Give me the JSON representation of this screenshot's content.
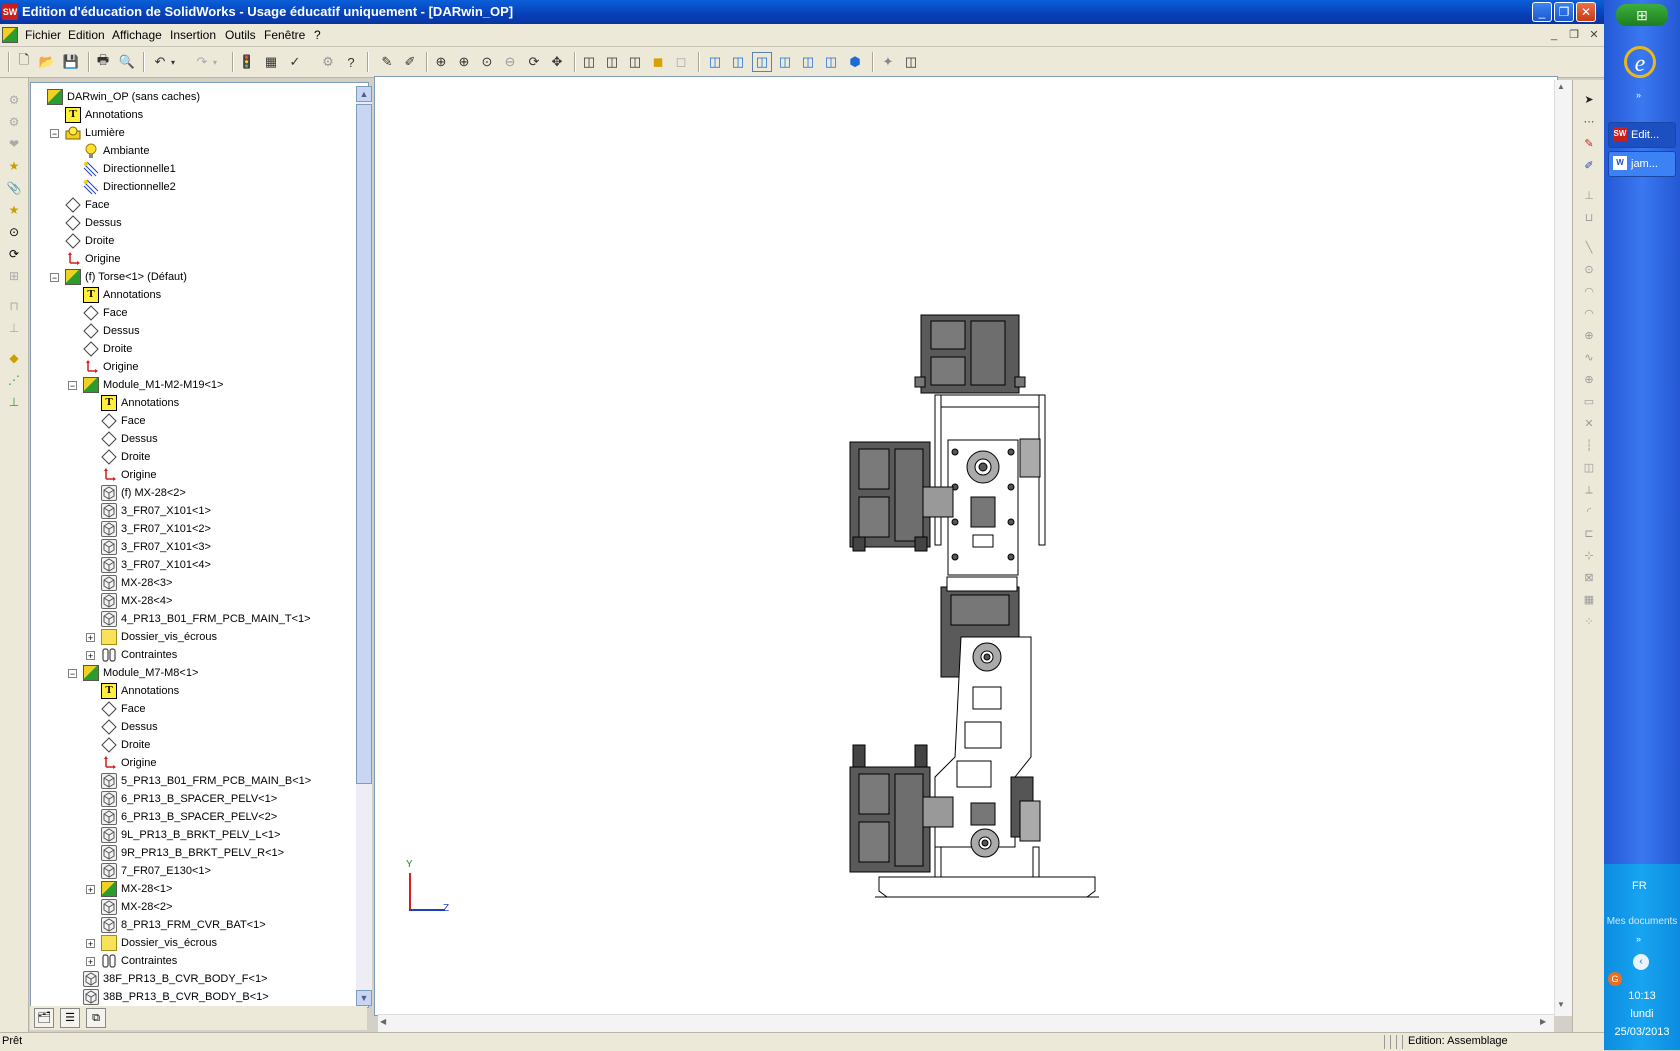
{
  "window": {
    "title": "Edition d'éducation de SolidWorks - Usage éducatif uniquement - [DARwin_OP]",
    "app_icon": "solidworks-logo",
    "controls": [
      "minimize",
      "restore",
      "close"
    ]
  },
  "menu": {
    "items": [
      "Fichier",
      "Edition",
      "Affichage",
      "Insertion",
      "Outils",
      "Fenêtre",
      "?"
    ]
  },
  "toolbar": {
    "buttons": [
      "new",
      "open",
      "save",
      "print",
      "print-preview",
      "undo",
      "redo",
      "rebuild",
      "options",
      "help",
      "zoom-to-fit",
      "zoom-in",
      "zoom-area",
      "zoom-out",
      "rotate",
      "pan",
      "front-view",
      "top-view",
      "right-view",
      "isometric-view",
      "wireframe",
      "hidden-lines",
      "shaded",
      "section",
      "perspective"
    ]
  },
  "tree": {
    "items": [
      {
        "label": "DARwin_OP  (sans caches)",
        "level": 0,
        "icon": "assembly-icon",
        "expander": ""
      },
      {
        "label": "Annotations",
        "level": 1,
        "icon": "annotation-icon",
        "expander": ""
      },
      {
        "label": "Lumière",
        "level": 1,
        "icon": "light-icon",
        "expander": "-"
      },
      {
        "label": "Ambiante",
        "level": 2,
        "icon": "bulb-icon",
        "expander": ""
      },
      {
        "label": "Directionnelle1",
        "level": 2,
        "icon": "directional-light-icon",
        "expander": ""
      },
      {
        "label": "Directionnelle2",
        "level": 2,
        "icon": "directional-light-icon",
        "expander": ""
      },
      {
        "label": "Face",
        "level": 1,
        "icon": "plane-icon",
        "expander": ""
      },
      {
        "label": "Dessus",
        "level": 1,
        "icon": "plane-icon",
        "expander": ""
      },
      {
        "label": "Droite",
        "level": 1,
        "icon": "plane-icon",
        "expander": ""
      },
      {
        "label": "Origine",
        "level": 1,
        "icon": "origin-icon",
        "expander": ""
      },
      {
        "label": "(f) Torse<1> (Défaut)",
        "level": 1,
        "icon": "assembly-icon",
        "expander": "-"
      },
      {
        "label": "Annotations",
        "level": 2,
        "icon": "annotation-icon",
        "expander": ""
      },
      {
        "label": "Face",
        "level": 2,
        "icon": "plane-icon",
        "expander": ""
      },
      {
        "label": "Dessus",
        "level": 2,
        "icon": "plane-icon",
        "expander": ""
      },
      {
        "label": "Droite",
        "level": 2,
        "icon": "plane-icon",
        "expander": ""
      },
      {
        "label": "Origine",
        "level": 2,
        "icon": "origin-icon",
        "expander": ""
      },
      {
        "label": "Module_M1-M2-M19<1>",
        "level": 2,
        "icon": "assembly-icon",
        "expander": "-"
      },
      {
        "label": "Annotations",
        "level": 3,
        "icon": "annotation-icon",
        "expander": ""
      },
      {
        "label": "Face",
        "level": 3,
        "icon": "plane-icon",
        "expander": ""
      },
      {
        "label": "Dessus",
        "level": 3,
        "icon": "plane-icon",
        "expander": ""
      },
      {
        "label": "Droite",
        "level": 3,
        "icon": "plane-icon",
        "expander": ""
      },
      {
        "label": "Origine",
        "level": 3,
        "icon": "origin-icon",
        "expander": ""
      },
      {
        "label": "(f) MX-28<2>",
        "level": 3,
        "icon": "part-icon",
        "expander": ""
      },
      {
        "label": "3_FR07_X101<1>",
        "level": 3,
        "icon": "part-icon",
        "expander": ""
      },
      {
        "label": "3_FR07_X101<2>",
        "level": 3,
        "icon": "part-icon",
        "expander": ""
      },
      {
        "label": "3_FR07_X101<3>",
        "level": 3,
        "icon": "part-icon",
        "expander": ""
      },
      {
        "label": "3_FR07_X101<4>",
        "level": 3,
        "icon": "part-icon",
        "expander": ""
      },
      {
        "label": "MX-28<3>",
        "level": 3,
        "icon": "part-icon",
        "expander": ""
      },
      {
        "label": "MX-28<4>",
        "level": 3,
        "icon": "part-icon",
        "expander": ""
      },
      {
        "label": "4_PR13_B01_FRM_PCB_MAIN_T<1>",
        "level": 3,
        "icon": "part-icon",
        "expander": ""
      },
      {
        "label": "Dossier_vis_écrous",
        "level": 3,
        "icon": "folder-icon",
        "expander": "+"
      },
      {
        "label": "Contraintes",
        "level": 3,
        "icon": "mates-icon",
        "expander": "+"
      },
      {
        "label": "Module_M7-M8<1>",
        "level": 2,
        "icon": "assembly-icon",
        "expander": "-"
      },
      {
        "label": "Annotations",
        "level": 3,
        "icon": "annotation-icon",
        "expander": ""
      },
      {
        "label": "Face",
        "level": 3,
        "icon": "plane-icon",
        "expander": ""
      },
      {
        "label": "Dessus",
        "level": 3,
        "icon": "plane-icon",
        "expander": ""
      },
      {
        "label": "Droite",
        "level": 3,
        "icon": "plane-icon",
        "expander": ""
      },
      {
        "label": "Origine",
        "level": 3,
        "icon": "origin-icon",
        "expander": ""
      },
      {
        "label": "5_PR13_B01_FRM_PCB_MAIN_B<1>",
        "level": 3,
        "icon": "part-icon",
        "expander": ""
      },
      {
        "label": "6_PR13_B_SPACER_PELV<1>",
        "level": 3,
        "icon": "part-icon",
        "expander": ""
      },
      {
        "label": "6_PR13_B_SPACER_PELV<2>",
        "level": 3,
        "icon": "part-icon",
        "expander": ""
      },
      {
        "label": "9L_PR13_B_BRKT_PELV_L<1>",
        "level": 3,
        "icon": "part-icon",
        "expander": ""
      },
      {
        "label": "9R_PR13_B_BRKT_PELV_R<1>",
        "level": 3,
        "icon": "part-icon",
        "expander": ""
      },
      {
        "label": "7_FR07_E130<1>",
        "level": 3,
        "icon": "part-icon",
        "expander": ""
      },
      {
        "label": "MX-28<1>",
        "level": 3,
        "icon": "assembly-icon",
        "expander": "+"
      },
      {
        "label": "MX-28<2>",
        "level": 3,
        "icon": "part-icon",
        "expander": ""
      },
      {
        "label": "8_PR13_FRM_CVR_BAT<1>",
        "level": 3,
        "icon": "part-icon",
        "expander": ""
      },
      {
        "label": "Dossier_vis_écrous",
        "level": 3,
        "icon": "folder-icon",
        "expander": "+"
      },
      {
        "label": "Contraintes",
        "level": 3,
        "icon": "mates-icon",
        "expander": "+"
      },
      {
        "label": "38F_PR13_B_CVR_BODY_F<1>",
        "level": 2,
        "icon": "part-icon",
        "expander": ""
      },
      {
        "label": "38B_PR13_B_CVR_BODY_B<1>",
        "level": 2,
        "icon": "part-icon",
        "expander": ""
      }
    ]
  },
  "panel_tabs": [
    "featuremanager-tab",
    "propertymanager-tab",
    "configurationmanager-tab"
  ],
  "viewport": {
    "triad": {
      "y_label": "Y",
      "z_label": "Z"
    }
  },
  "statusbar": {
    "left": "Prêt",
    "right": "Edition: Assemblage"
  },
  "taskbar": {
    "buttons": [
      {
        "label": "Edit...",
        "icon": "solidworks-icon"
      },
      {
        "label": "jam...",
        "icon": "word-icon"
      }
    ],
    "lang": "FR",
    "my_documents": "Mes documents",
    "time": "10:13",
    "day": "lundi",
    "date": "25/03/2013"
  }
}
